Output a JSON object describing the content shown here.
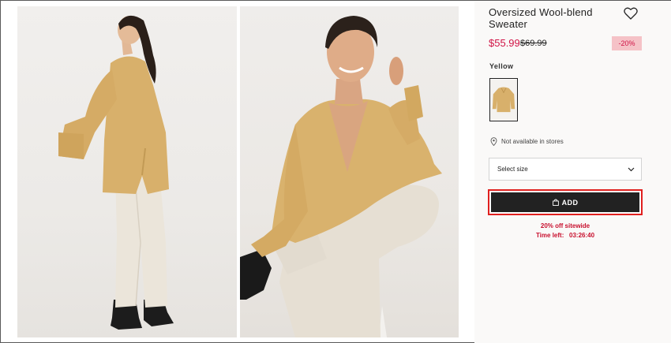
{
  "product": {
    "title": "Oversized Wool-blend Sweater",
    "sale_price": "$55.99",
    "original_price": "$69.99",
    "discount_badge": "-20%",
    "color_label": "Yellow",
    "availability": "Not available in stores",
    "size_placeholder": "Select size",
    "add_label": "ADD",
    "promo_line": "20% off sitewide",
    "timer_label": "Time left:",
    "timer_value": "03:26:40"
  },
  "icons": {
    "wishlist": "heart-icon",
    "location": "pin-icon",
    "dropdown": "chevron-down-icon",
    "bag": "shopping-bag-icon"
  },
  "colors": {
    "sale": "#d01345",
    "badge_bg": "#f5c2c7",
    "button_bg": "#222222",
    "focus_outline": "#e0201f",
    "sweater": "#d9b26d",
    "trousers": "#e8e1d6"
  }
}
